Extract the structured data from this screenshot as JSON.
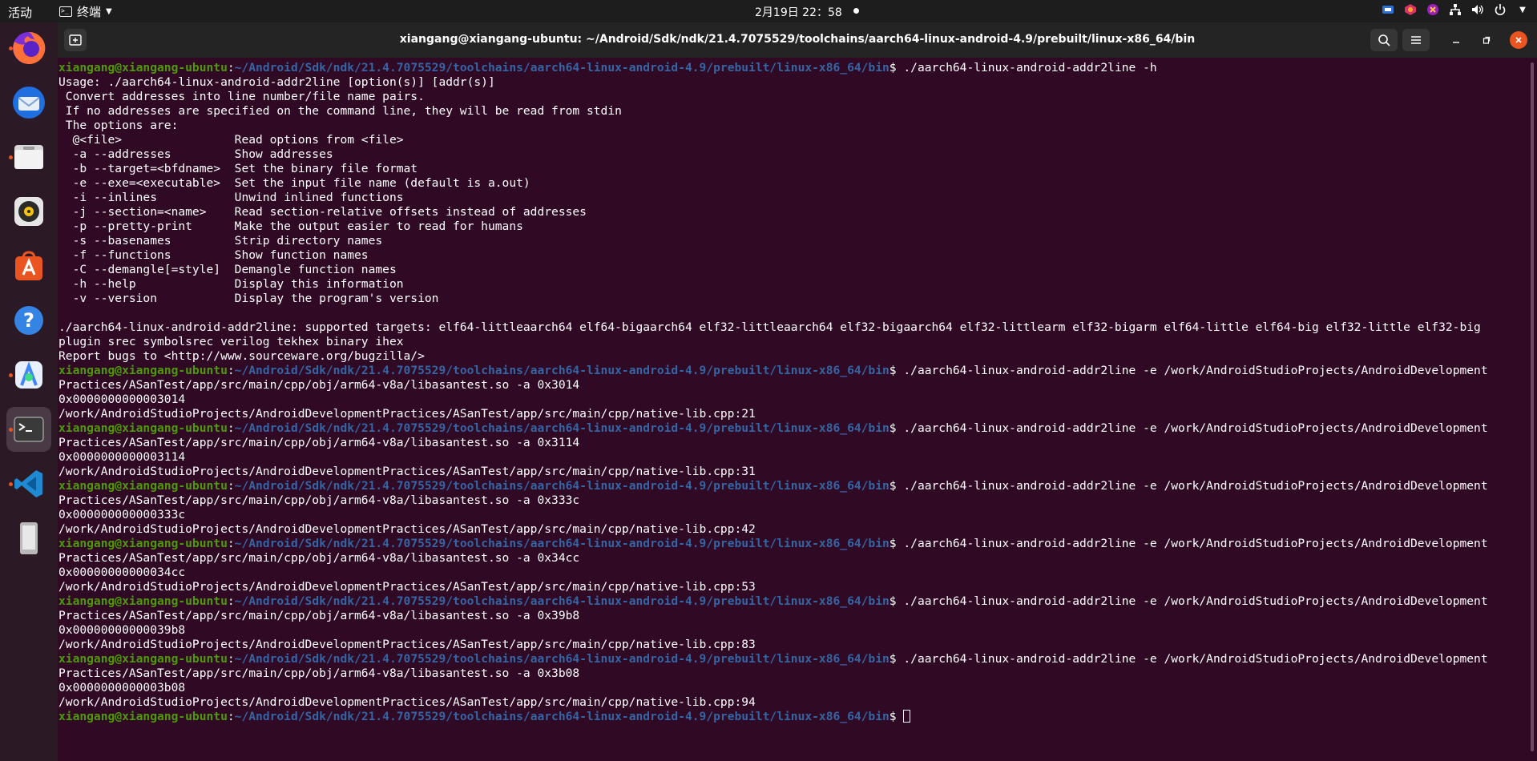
{
  "topbar": {
    "activities": "活动",
    "app_menu_label": "终端",
    "clock": "2月19日  22：58",
    "accent_color": "#e95420"
  },
  "dock": {
    "items": [
      {
        "name": "firefox-icon",
        "running": true
      },
      {
        "name": "thunderbird-icon",
        "running": false
      },
      {
        "name": "files-icon",
        "running": true
      },
      {
        "name": "rhythmbox-icon",
        "running": false
      },
      {
        "name": "software-store-icon",
        "running": false
      },
      {
        "name": "help-icon",
        "running": false
      },
      {
        "name": "android-studio-icon",
        "running": true
      },
      {
        "name": "terminal-icon",
        "running": true
      },
      {
        "name": "vscode-icon",
        "running": true
      },
      {
        "name": "device-icon",
        "running": false
      }
    ]
  },
  "window": {
    "title": "xiangang@xiangang-ubuntu: ~/Android/Sdk/ndk/21.4.7075529/toolchains/aarch64-linux-android-4.9/prebuilt/linux-x86_64/bin"
  },
  "terminal": {
    "prompt_user": "xiangang@xiangang-ubuntu",
    "prompt_path": "~/Android/Sdk/ndk/21.4.7075529/toolchains/aarch64-linux-android-4.9/prebuilt/linux-x86_64/bin",
    "lines": [
      {
        "t": "prompt",
        "cmd": "./aarch64-linux-android-addr2line -h"
      },
      {
        "t": "out",
        "text": "Usage: ./aarch64-linux-android-addr2line [option(s)] [addr(s)]"
      },
      {
        "t": "out",
        "text": " Convert addresses into line number/file name pairs."
      },
      {
        "t": "out",
        "text": " If no addresses are specified on the command line, they will be read from stdin"
      },
      {
        "t": "out",
        "text": " The options are:"
      },
      {
        "t": "out",
        "text": "  @<file>                Read options from <file>"
      },
      {
        "t": "out",
        "text": "  -a --addresses         Show addresses"
      },
      {
        "t": "out",
        "text": "  -b --target=<bfdname>  Set the binary file format"
      },
      {
        "t": "out",
        "text": "  -e --exe=<executable>  Set the input file name (default is a.out)"
      },
      {
        "t": "out",
        "text": "  -i --inlines           Unwind inlined functions"
      },
      {
        "t": "out",
        "text": "  -j --section=<name>    Read section-relative offsets instead of addresses"
      },
      {
        "t": "out",
        "text": "  -p --pretty-print      Make the output easier to read for humans"
      },
      {
        "t": "out",
        "text": "  -s --basenames         Strip directory names"
      },
      {
        "t": "out",
        "text": "  -f --functions         Show function names"
      },
      {
        "t": "out",
        "text": "  -C --demangle[=style]  Demangle function names"
      },
      {
        "t": "out",
        "text": "  -h --help              Display this information"
      },
      {
        "t": "out",
        "text": "  -v --version           Display the program's version"
      },
      {
        "t": "out",
        "text": ""
      },
      {
        "t": "out",
        "text": "./aarch64-linux-android-addr2line: supported targets: elf64-littleaarch64 elf64-bigaarch64 elf32-littleaarch64 elf32-bigaarch64 elf32-littlearm elf32-bigarm elf64-little elf64-big elf32-little elf32-big"
      },
      {
        "t": "out",
        "text": "plugin srec symbolsrec verilog tekhex binary ihex"
      },
      {
        "t": "out",
        "text": "Report bugs to <http://www.sourceware.org/bugzilla/>"
      },
      {
        "t": "prompt",
        "cmd": "./aarch64-linux-android-addr2line -e /work/AndroidStudioProjects/AndroidDevelopment"
      },
      {
        "t": "out",
        "text": "Practices/ASanTest/app/src/main/cpp/obj/arm64-v8a/libasantest.so -a 0x3014"
      },
      {
        "t": "out",
        "text": "0x0000000000003014"
      },
      {
        "t": "out",
        "text": "/work/AndroidStudioProjects/AndroidDevelopmentPractices/ASanTest/app/src/main/cpp/native-lib.cpp:21"
      },
      {
        "t": "prompt",
        "cmd": "./aarch64-linux-android-addr2line -e /work/AndroidStudioProjects/AndroidDevelopment"
      },
      {
        "t": "out",
        "text": "Practices/ASanTest/app/src/main/cpp/obj/arm64-v8a/libasantest.so -a 0x3114"
      },
      {
        "t": "out",
        "text": "0x0000000000003114"
      },
      {
        "t": "out",
        "text": "/work/AndroidStudioProjects/AndroidDevelopmentPractices/ASanTest/app/src/main/cpp/native-lib.cpp:31"
      },
      {
        "t": "prompt",
        "cmd": "./aarch64-linux-android-addr2line -e /work/AndroidStudioProjects/AndroidDevelopment"
      },
      {
        "t": "out",
        "text": "Practices/ASanTest/app/src/main/cpp/obj/arm64-v8a/libasantest.so -a 0x333c"
      },
      {
        "t": "out",
        "text": "0x000000000000333c"
      },
      {
        "t": "out",
        "text": "/work/AndroidStudioProjects/AndroidDevelopmentPractices/ASanTest/app/src/main/cpp/native-lib.cpp:42"
      },
      {
        "t": "prompt",
        "cmd": "./aarch64-linux-android-addr2line -e /work/AndroidStudioProjects/AndroidDevelopment"
      },
      {
        "t": "out",
        "text": "Practices/ASanTest/app/src/main/cpp/obj/arm64-v8a/libasantest.so -a 0x34cc"
      },
      {
        "t": "out",
        "text": "0x00000000000034cc"
      },
      {
        "t": "out",
        "text": "/work/AndroidStudioProjects/AndroidDevelopmentPractices/ASanTest/app/src/main/cpp/native-lib.cpp:53"
      },
      {
        "t": "prompt",
        "cmd": "./aarch64-linux-android-addr2line -e /work/AndroidStudioProjects/AndroidDevelopment"
      },
      {
        "t": "out",
        "text": "Practices/ASanTest/app/src/main/cpp/obj/arm64-v8a/libasantest.so -a 0x39b8"
      },
      {
        "t": "out",
        "text": "0x00000000000039b8"
      },
      {
        "t": "out",
        "text": "/work/AndroidStudioProjects/AndroidDevelopmentPractices/ASanTest/app/src/main/cpp/native-lib.cpp:83"
      },
      {
        "t": "prompt",
        "cmd": "./aarch64-linux-android-addr2line -e /work/AndroidStudioProjects/AndroidDevelopment"
      },
      {
        "t": "out",
        "text": "Practices/ASanTest/app/src/main/cpp/obj/arm64-v8a/libasantest.so -a 0x3b08"
      },
      {
        "t": "out",
        "text": "0x0000000000003b08"
      },
      {
        "t": "out",
        "text": "/work/AndroidStudioProjects/AndroidDevelopmentPractices/ASanTest/app/src/main/cpp/native-lib.cpp:94"
      },
      {
        "t": "prompt",
        "cmd": "",
        "cursor": true
      }
    ]
  }
}
